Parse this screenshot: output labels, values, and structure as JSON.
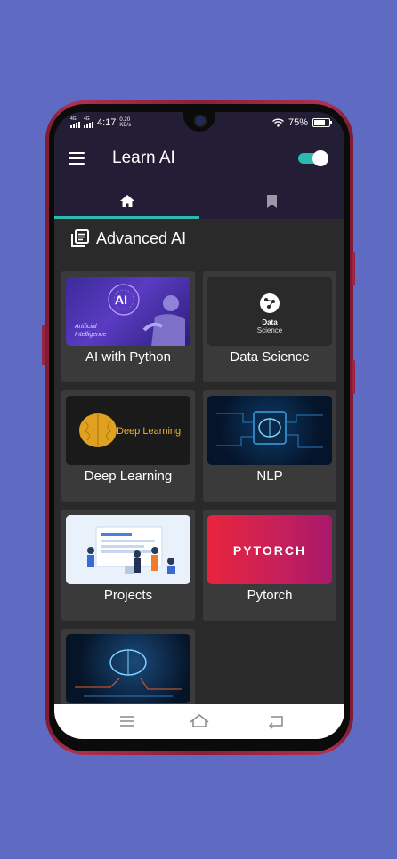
{
  "status_bar": {
    "net1": "4G",
    "net2": "4G",
    "time": "4:17",
    "speed_value": "0.20",
    "speed_unit": "KB/s",
    "battery": "75%",
    "battery_level": 0.75
  },
  "app_bar": {
    "title": "Learn AI",
    "dark_mode_enabled": true
  },
  "tabs": [
    {
      "icon": "home-icon",
      "selected": true
    },
    {
      "icon": "bookmark-icon",
      "selected": false
    }
  ],
  "section": {
    "title": "Advanced AI"
  },
  "courses": [
    {
      "label": "AI with Python",
      "thumb_text_1": "AI",
      "thumb_text_2": "Artificial",
      "thumb_text_3": "Intelligence"
    },
    {
      "label": "Data Science",
      "thumb_text_1": "Data",
      "thumb_text_2": "Science"
    },
    {
      "label": "Deep Learning",
      "thumb_text_1": "Deep Learning"
    },
    {
      "label": "NLP"
    },
    {
      "label": "Projects"
    },
    {
      "label": "Pytorch",
      "thumb_text_1": "PYTORCH"
    }
  ],
  "colors": {
    "background": "#5f6bc2",
    "app_bar": "#231e35",
    "accent": "#2db9ad",
    "content_bg": "#2a2a2a",
    "card_bg": "#3a3a3a"
  }
}
